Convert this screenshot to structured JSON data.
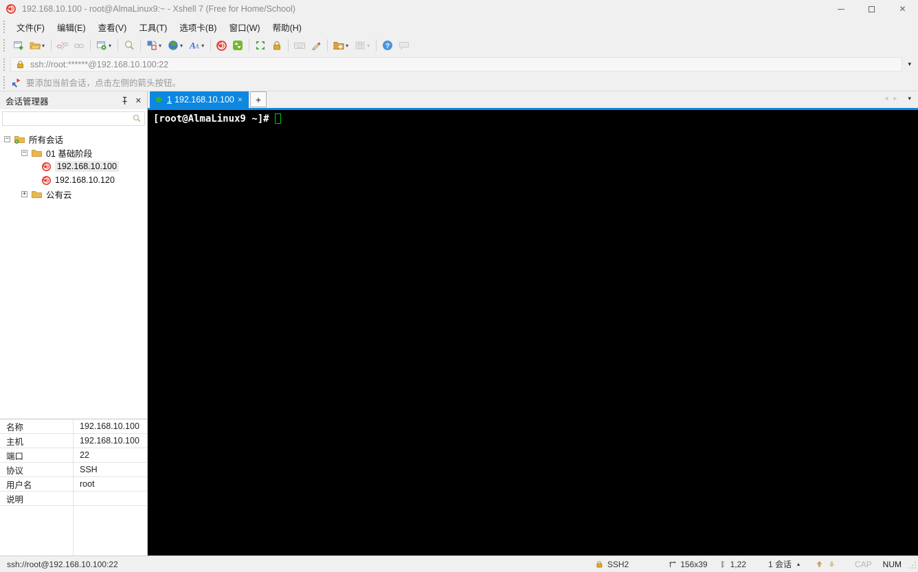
{
  "colors": {
    "accent_blue": "#0d87e0",
    "tab_green_dot": "#2db52d",
    "terminal_cursor_green": "#00cc00",
    "xshell_red": "#e2483d",
    "lock_gold": "#ddab35",
    "terminal_bg": "#000000"
  },
  "glyphs": {
    "close": "✕",
    "dropdown": "▾",
    "plus": "+",
    "minus": "−",
    "scroll_left": "◂",
    "scroll_right": "▸",
    "caret_up": "▴",
    "question": "?"
  },
  "window": {
    "title": "192.168.10.100 - root@AlmaLinux9:~ - Xshell 7 (Free for Home/School)"
  },
  "menu": {
    "items": [
      "文件(F)",
      "编辑(E)",
      "查看(V)",
      "工具(T)",
      "选项卡(B)",
      "窗口(W)",
      "帮助(H)"
    ]
  },
  "addressbar": {
    "value": "ssh://root:******@192.168.10.100:22"
  },
  "infobar": {
    "message": "要添加当前会话，点击左侧的箭头按钮。"
  },
  "session_manager": {
    "title": "会话管理器",
    "search_value": "",
    "tree": [
      {
        "expander": "−",
        "label": "所有会话"
      },
      {
        "expander": "−",
        "label": "01 基础阶段"
      },
      {
        "expander": "",
        "label": "192.168.10.100"
      },
      {
        "expander": "",
        "label": "192.168.10.120"
      },
      {
        "expander": "+",
        "label": "公有云"
      }
    ],
    "properties": [
      {
        "label": "名称",
        "value": "192.168.10.100"
      },
      {
        "label": "主机",
        "value": "192.168.10.100"
      },
      {
        "label": "端口",
        "value": "22"
      },
      {
        "label": "协议",
        "value": "SSH"
      },
      {
        "label": "用户名",
        "value": "root"
      },
      {
        "label": "说明",
        "value": ""
      }
    ]
  },
  "tabs": {
    "active": {
      "index": "1",
      "label": "192.168.10.100"
    }
  },
  "terminal": {
    "prompt": "[root@AlmaLinux9 ~]#"
  },
  "statusbar": {
    "left": "ssh://root@192.168.10.100:22",
    "protocol": "SSH2",
    "size": "156x39",
    "position": "1,22",
    "sessions": "1 会话",
    "cap": "CAP",
    "num": "NUM"
  },
  "toolbar": {
    "icons": [
      "new-session",
      "open-folder",
      "disconnect",
      "reconnect",
      "session-properties",
      "find",
      "compose-layout",
      "encoding-globe",
      "font",
      "xshell",
      "xftp",
      "fullscreen",
      "lock",
      "virtual-keyboard",
      "highlighter",
      "new-file-transfer",
      "log-table",
      "help",
      "feedback"
    ]
  }
}
